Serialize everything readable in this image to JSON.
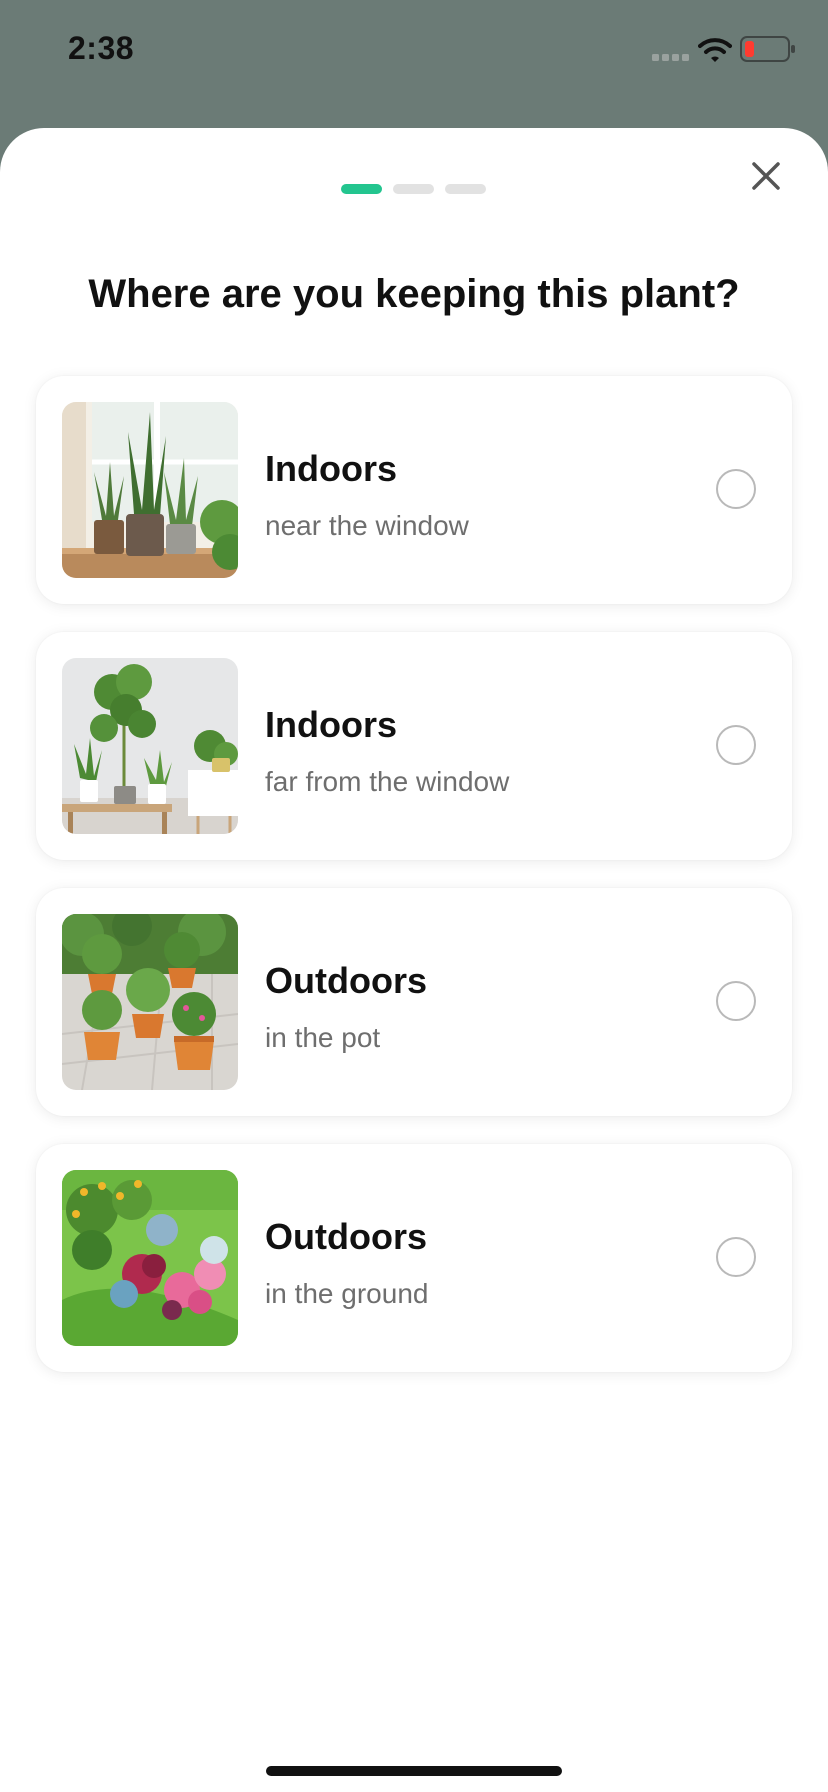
{
  "status_bar": {
    "time": "2:38",
    "icons": [
      "signal-icon",
      "wifi-icon",
      "battery-icon"
    ],
    "battery_color": "#ff3b30"
  },
  "progress": {
    "total_steps": 3,
    "current_step": 1,
    "active_color": "#23c58f"
  },
  "close_icon": "close-icon",
  "title": "Where are you keeping this plant?",
  "options": [
    {
      "title": "Indoors",
      "subtitle": "near the window",
      "image": "snake-plants-on-windowsill",
      "selected": false
    },
    {
      "title": "Indoors",
      "subtitle": "far from the window",
      "image": "potted-plants-in-room",
      "selected": false
    },
    {
      "title": "Outdoors",
      "subtitle": "in the pot",
      "image": "potted-plants-on-patio",
      "selected": false
    },
    {
      "title": "Outdoors",
      "subtitle": "in the ground",
      "image": "garden-flower-bed",
      "selected": false
    }
  ]
}
